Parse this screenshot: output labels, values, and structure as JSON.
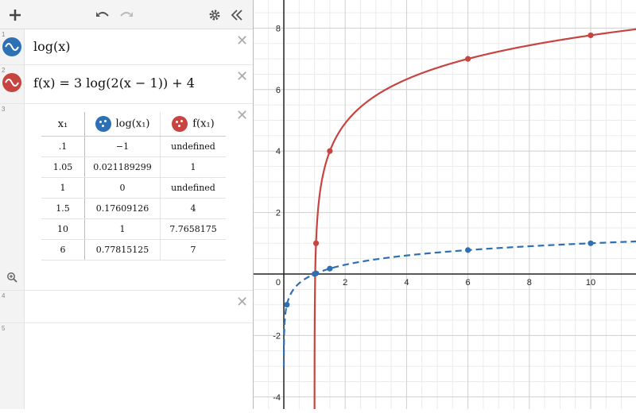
{
  "toolbar": {
    "add_icon": "plus-icon",
    "undo_icon": "undo-icon",
    "redo_icon": "redo-icon",
    "settings_icon": "gear-icon",
    "collapse_icon": "double-chevron-left-icon"
  },
  "expressions": [
    {
      "num": "1",
      "latex": "log(x)",
      "color": "#2d70b3"
    },
    {
      "num": "2",
      "latex": "f(x) = 3 log(2(x − 1)) + 4",
      "color": "#c74440"
    },
    {
      "num": "3"
    },
    {
      "num": "4"
    },
    {
      "num": "5"
    }
  ],
  "table": {
    "headers": [
      "x₁",
      "log(x₁)",
      "f(x₁)"
    ],
    "rows": [
      [
        ".1",
        "−1",
        "undefined"
      ],
      [
        "1.05",
        "0.021189299",
        "1"
      ],
      [
        "1",
        "0",
        "undefined"
      ],
      [
        "1.5",
        "0.17609126",
        "4"
      ],
      [
        "10",
        "1",
        "7.7658175"
      ],
      [
        "6",
        "0.77815125",
        "7"
      ]
    ]
  },
  "zoom_icon": "zoom-fit-icon",
  "colors": {
    "blue": "#2d70b3",
    "red": "#c74440"
  },
  "chart_data": {
    "type": "line",
    "xlim": [
      -1,
      11.5
    ],
    "ylim": [
      -4.4,
      8.9
    ],
    "x_ticks": [
      "0",
      "2",
      "4",
      "6",
      "8",
      "10"
    ],
    "y_ticks": [
      "-4",
      "-2",
      "2",
      "4",
      "6",
      "8"
    ],
    "grid": true,
    "series": [
      {
        "function": "log10(x)",
        "style": "dashed",
        "color": "#2d70b3",
        "points": [
          [
            0.1,
            -1
          ],
          [
            1.05,
            0.0212
          ],
          [
            1,
            0
          ],
          [
            1.5,
            0.1761
          ],
          [
            10,
            1
          ],
          [
            6,
            0.7782
          ]
        ]
      },
      {
        "function": "3*log10(2*(x-1))+4",
        "style": "solid",
        "color": "#c74440",
        "points": [
          [
            1.05,
            1
          ],
          [
            1.5,
            4
          ],
          [
            10,
            7.7658
          ],
          [
            6,
            7
          ]
        ]
      }
    ]
  }
}
